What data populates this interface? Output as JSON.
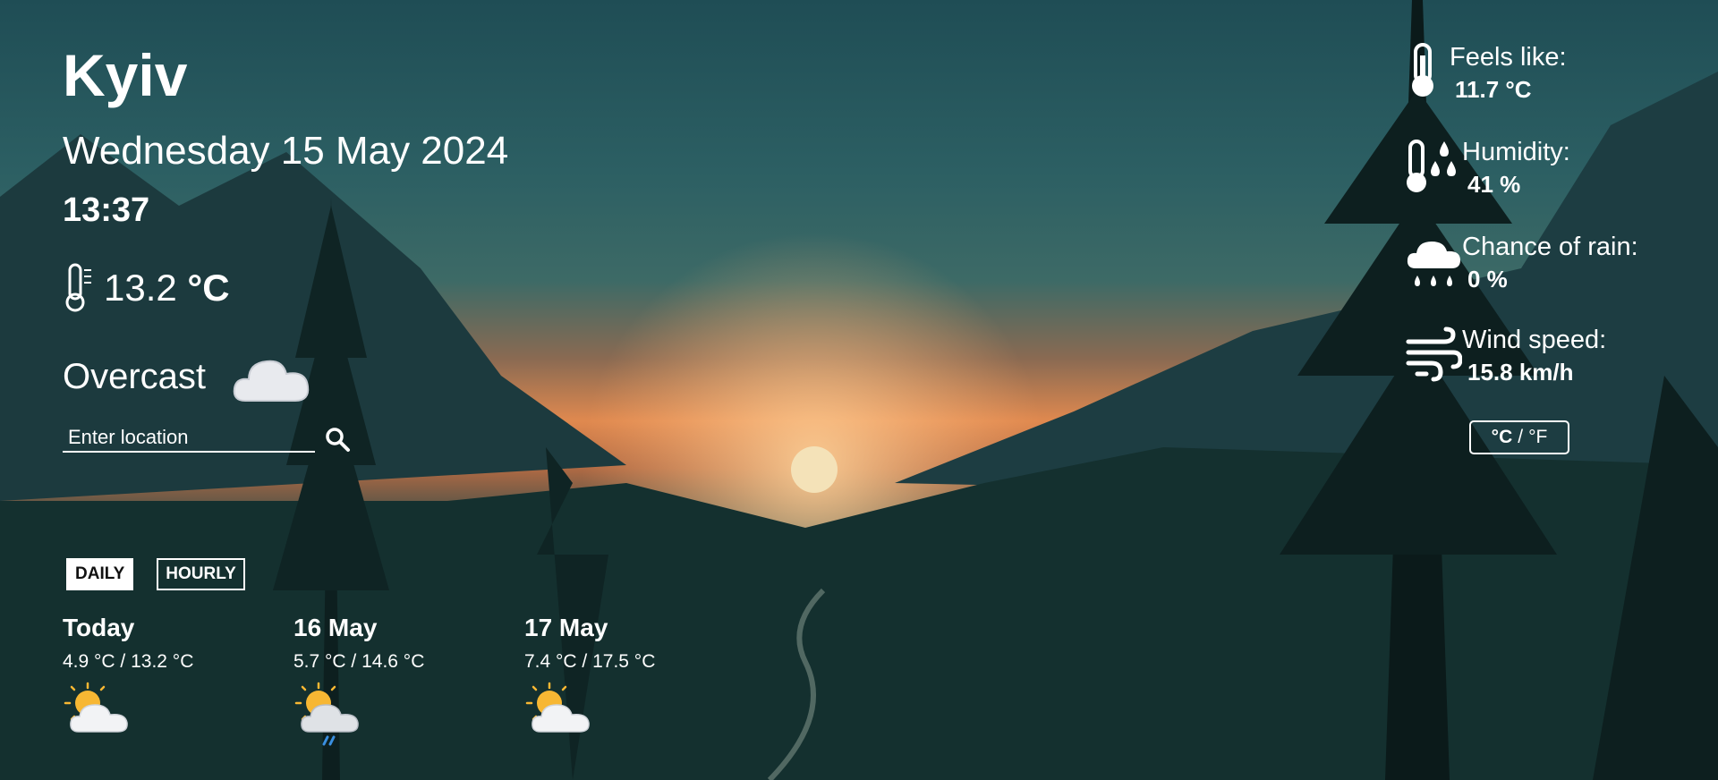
{
  "location": {
    "city": "Kyiv"
  },
  "datetime": {
    "date": "Wednesday 15 May 2024",
    "time": "13:37"
  },
  "current": {
    "temp_value": "13.2",
    "temp_unit": "°C",
    "condition": "Overcast",
    "condition_icon": "cloud-icon"
  },
  "search": {
    "placeholder": "Enter location",
    "button_icon": "search-icon"
  },
  "tabs": [
    {
      "label": "DAILY",
      "active": true
    },
    {
      "label": "HOURLY",
      "active": false
    }
  ],
  "forecast": [
    {
      "title": "Today",
      "range": "4.9 °C / 13.2 °C",
      "icon": "partly-cloudy-icon"
    },
    {
      "title": "16 May",
      "range": "5.7 °C / 14.6 °C",
      "icon": "partly-cloudy-rain-icon"
    },
    {
      "title": "17 May",
      "range": "7.4 °C / 17.5 °C",
      "icon": "partly-cloudy-icon"
    }
  ],
  "details": [
    {
      "label": "Feels like:",
      "value": "11.7 °C",
      "icon": "thermometer-icon"
    },
    {
      "label": "Humidity:",
      "value": "41 %",
      "icon": "humidity-icon"
    },
    {
      "label": "Chance of rain:",
      "value": "0 %",
      "icon": "rain-cloud-icon"
    },
    {
      "label": "Wind speed:",
      "value": "15.8 km/h",
      "icon": "wind-icon"
    }
  ],
  "unit_toggle": {
    "celsius": "°C",
    "separator": "/",
    "fahrenheit": "°F"
  },
  "colors": {
    "text": "#ffffff",
    "sun": "#f7b733",
    "rain": "#3a8fe0"
  }
}
